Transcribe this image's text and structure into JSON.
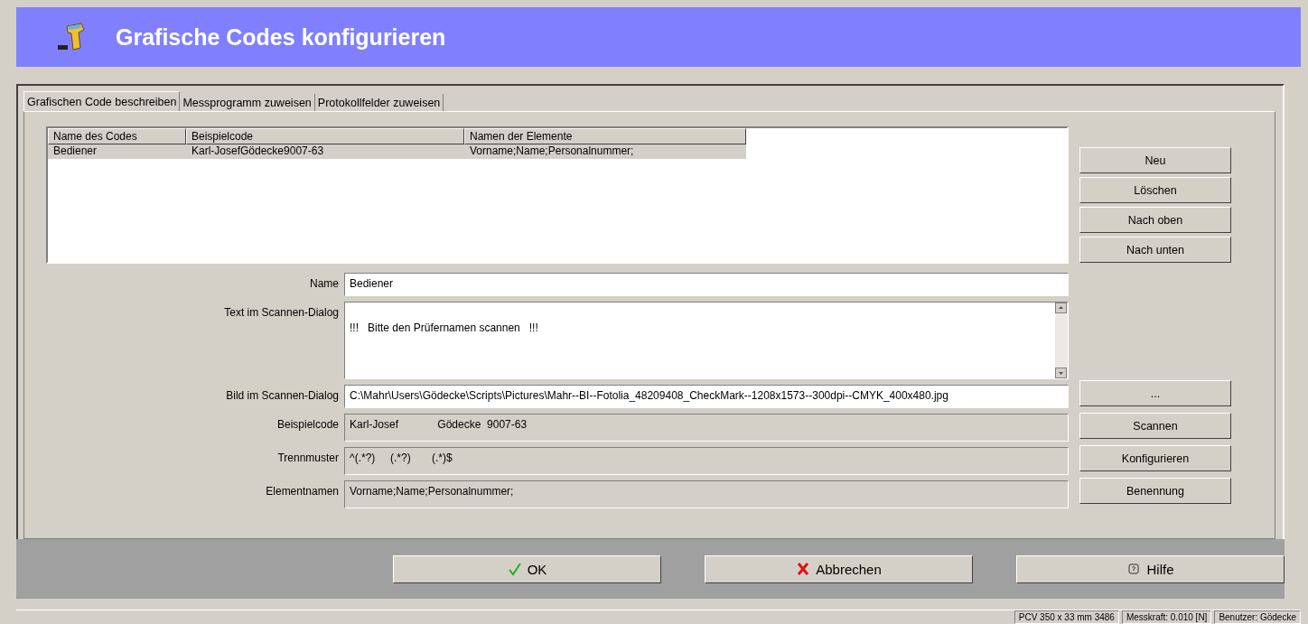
{
  "window": {
    "title": "Grafische Codes konfigurieren"
  },
  "tabs": [
    {
      "label": "Grafischen Code beschreiben",
      "selected": true
    },
    {
      "label": "Messprogramm zuweisen",
      "selected": false
    },
    {
      "label": "Protokollfelder zuweisen",
      "selected": false
    }
  ],
  "table": {
    "columns": [
      "Name des Codes",
      "Beispielcode",
      "Namen der Elemente"
    ],
    "rows": [
      {
        "cells": [
          "Bediener",
          "Karl-JosefGödecke9007-63",
          "Vorname;Name;Personalnummer;"
        ],
        "selected": true
      }
    ]
  },
  "list_buttons": [
    "Neu",
    "Löschen",
    "Nach oben",
    "Nach unten"
  ],
  "fields": [
    {
      "label": "Name",
      "kind": "input",
      "value": "Bediener"
    },
    {
      "label": "Text im Scannen-Dialog",
      "kind": "textarea",
      "value": "!!!   Bitte den Prüfernamen scannen   !!!"
    },
    {
      "label": "Bild im Scannen-Dialog",
      "kind": "input",
      "value": "C:\\Mahr\\Users\\Gödecke\\Scripts\\Pictures\\Mahr--BI--Fotolia_48209408_CheckMark--1208x1573--300dpi--CMYK_400x480.jpg",
      "button": "..."
    },
    {
      "label": "Beispielcode",
      "kind": "readonly",
      "value": "Karl-Josef             Gödecke  9007-63",
      "button": "Scannen"
    },
    {
      "label": "Trennmuster",
      "kind": "readonly",
      "value": "^(.*?)     (.*?)       (.*)$",
      "button": "Konfigurieren"
    },
    {
      "label": "Elementnamen",
      "kind": "readonly",
      "value": "Vorname;Name;Personalnummer;",
      "button": "Benennung"
    }
  ],
  "dialog_buttons": [
    {
      "label": "OK",
      "kind": "ok"
    },
    {
      "label": "Abbrechen",
      "kind": "cancel"
    },
    {
      "label": "Hilfe",
      "kind": "help"
    }
  ],
  "status_bar": [
    "PCV 350 x 33 mm 3486",
    "Messkraft: 0.010 [N]",
    "Benutzer: Gödecke"
  ]
}
